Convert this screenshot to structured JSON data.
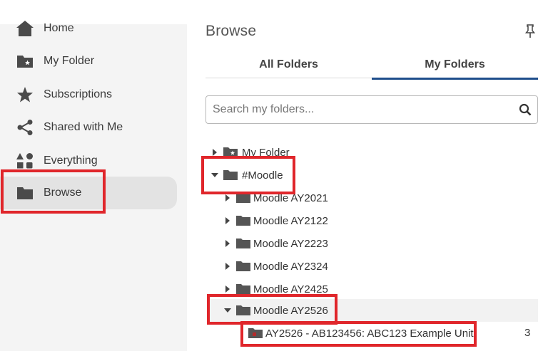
{
  "sidebar": {
    "items": [
      {
        "label": "Home",
        "icon": "home-icon"
      },
      {
        "label": "My Folder",
        "icon": "star-folder-icon"
      },
      {
        "label": "Subscriptions",
        "icon": "star-icon"
      },
      {
        "label": "Shared with Me",
        "icon": "share-icon"
      },
      {
        "label": "Everything",
        "icon": "shapes-icon"
      },
      {
        "label": "Browse",
        "icon": "folder-icon",
        "active": true
      }
    ]
  },
  "panel": {
    "title": "Browse",
    "tabs": [
      {
        "label": "All Folders",
        "active": false
      },
      {
        "label": "My Folders",
        "active": true
      }
    ],
    "search": {
      "placeholder": "Search my folders...",
      "value": ""
    }
  },
  "tree": [
    {
      "label": "My Folder",
      "expanded": false
    },
    {
      "label": "#Moodle",
      "expanded": true
    },
    {
      "label": "Moodle AY2021",
      "expanded": false
    },
    {
      "label": "Moodle AY2122",
      "expanded": false
    },
    {
      "label": "Moodle AY2223",
      "expanded": false
    },
    {
      "label": "Moodle AY2324",
      "expanded": false
    },
    {
      "label": "Moodle AY2425",
      "expanded": false
    },
    {
      "label": "Moodle AY2526",
      "expanded": true
    },
    {
      "label": "AY2526 - AB123456: ABC123 Example Unit",
      "count": "3"
    }
  ],
  "colors": {
    "accent": "#1f4e8c",
    "annotation": "#e0262b",
    "icon": "#4a4a4a",
    "unit_folder": "#b32b2b"
  }
}
